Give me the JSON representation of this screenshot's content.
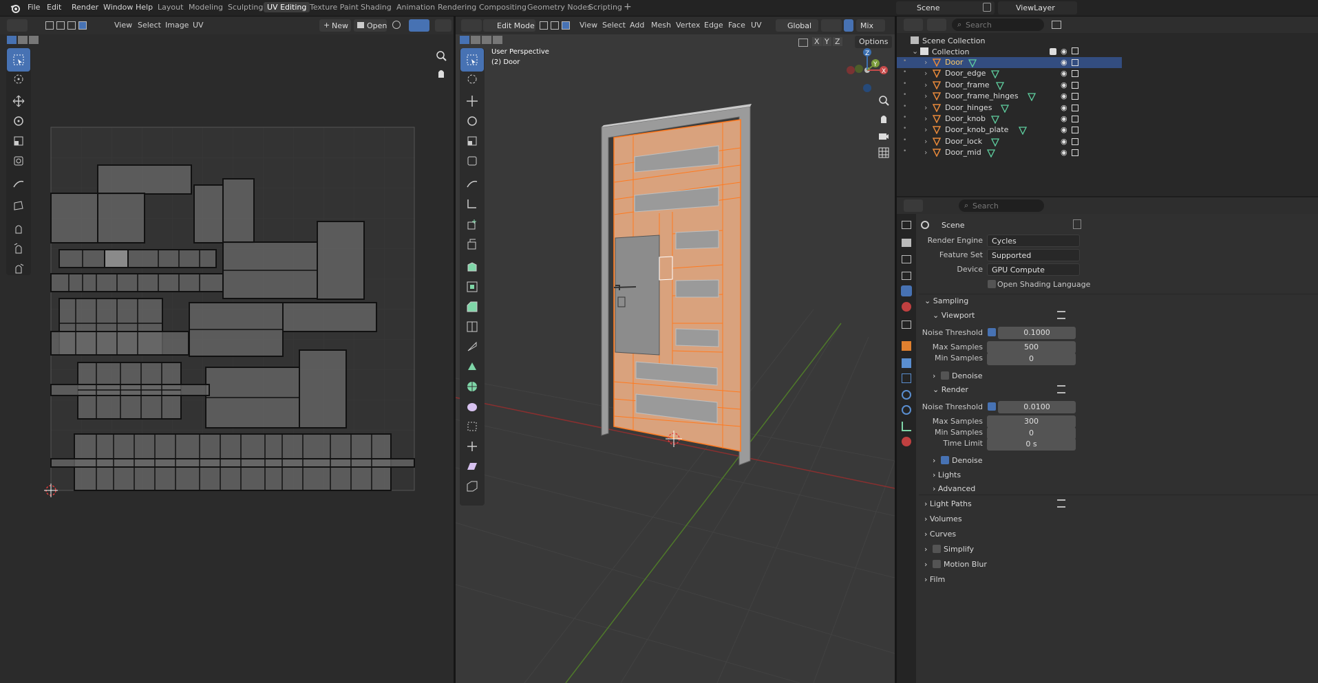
{
  "app": {
    "name": "Blender"
  },
  "menu": {
    "file": "File",
    "edit": "Edit",
    "render": "Render",
    "window": "Window",
    "help": "Help"
  },
  "workspaces": [
    "Layout",
    "Modeling",
    "Sculpting",
    "UV Editing",
    "Texture Paint",
    "Shading",
    "Animation",
    "Rendering",
    "Compositing",
    "Geometry Nodes",
    "Scripting"
  ],
  "active_workspace": "UV Editing",
  "scene_selector": {
    "value": "Scene"
  },
  "viewlayer_selector": {
    "value": "ViewLayer"
  },
  "uv_editor": {
    "menus": [
      "View",
      "Select",
      "Image",
      "UV"
    ],
    "new_label": "New",
    "open_label": "Open"
  },
  "viewport": {
    "mode": "Edit Mode",
    "menus": [
      "View",
      "Select",
      "Add",
      "Mesh",
      "Vertex",
      "Edge",
      "Face",
      "UV"
    ],
    "orientation": "Global",
    "shading": "Mix",
    "options_label": "Options",
    "axis_x": "X",
    "axis_y": "Y",
    "axis_z": "Z",
    "overlay_title": "User Perspective",
    "overlay_object": "(2) Door"
  },
  "outliner": {
    "search_placeholder": "Search",
    "scene_collection": "Scene Collection",
    "collection": "Collection",
    "items": [
      {
        "name": "Door",
        "selected": true
      },
      {
        "name": "Door_edge",
        "selected": false
      },
      {
        "name": "Door_frame",
        "selected": false
      },
      {
        "name": "Door_frame_hinges",
        "selected": false
      },
      {
        "name": "Door_hinges",
        "selected": false
      },
      {
        "name": "Door_knob",
        "selected": false
      },
      {
        "name": "Door_knob_plate",
        "selected": false
      },
      {
        "name": "Door_lock",
        "selected": false
      },
      {
        "name": "Door_mid",
        "selected": false
      }
    ]
  },
  "properties": {
    "search_placeholder": "Search",
    "context": "Scene",
    "render_engine_label": "Render Engine",
    "render_engine": "Cycles",
    "feature_set_label": "Feature Set",
    "feature_set": "Supported",
    "device_label": "Device",
    "device": "GPU Compute",
    "osl_label": "Open Shading Language",
    "sampling": "Sampling",
    "viewport": "Viewport",
    "noise_threshold_label": "Noise Threshold",
    "vp_noise_threshold": "0.1000",
    "max_samples_label": "Max Samples",
    "vp_max_samples": "500",
    "min_samples_label": "Min Samples",
    "vp_min_samples": "0",
    "denoise_label": "Denoise",
    "render": "Render",
    "r_noise_threshold": "0.0100",
    "r_max_samples": "300",
    "r_min_samples": "0",
    "time_limit_label": "Time Limit",
    "r_time_limit": "0 s",
    "lights": "Lights",
    "advanced": "Advanced",
    "light_paths": "Light Paths",
    "volumes": "Volumes",
    "curves": "Curves",
    "simplify": "Simplify",
    "motion_blur": "Motion Blur",
    "film": "Film"
  },
  "colors": {
    "accent": "#4772b3",
    "selected_row": "#334d80",
    "edge_orange": "#ff7a1f",
    "face_orange": "#d9a27d",
    "axis_red": "#8a2f2f",
    "axis_green": "#5c8a2f"
  }
}
